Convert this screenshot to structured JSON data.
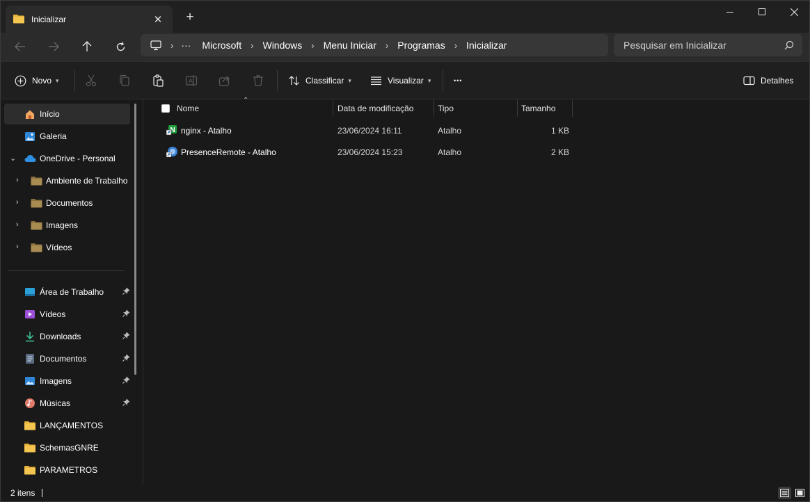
{
  "window": {
    "tab_title": "Inicializar",
    "tab_close": "✕",
    "new_tab": "+",
    "minimize": "minimize",
    "maximize": "maximize",
    "close": "close"
  },
  "address": {
    "overflow": "···",
    "crumbs": [
      "Microsoft",
      "Windows",
      "Menu Iniciar",
      "Programas",
      "Inicializar"
    ],
    "search_placeholder": "Pesquisar em Inicializar"
  },
  "toolbar": {
    "new_label": "Novo",
    "sort_label": "Classificar",
    "view_label": "Visualizar",
    "more_label": "•••",
    "details_label": "Detalhes"
  },
  "sidebar": {
    "top": [
      {
        "label": "Início"
      },
      {
        "label": "Galeria"
      },
      {
        "label": "OneDrive - Personal"
      }
    ],
    "onedrive_children": [
      {
        "label": "Ambiente de Trabalho"
      },
      {
        "label": "Documentos"
      },
      {
        "label": "Imagens"
      },
      {
        "label": "Vídeos"
      }
    ],
    "quick": [
      {
        "label": "Área de Trabalho",
        "pinned": true
      },
      {
        "label": "Vídeos",
        "pinned": true
      },
      {
        "label": "Downloads",
        "pinned": true
      },
      {
        "label": "Documentos",
        "pinned": true
      },
      {
        "label": "Imagens",
        "pinned": true
      },
      {
        "label": "Músicas",
        "pinned": true
      },
      {
        "label": "LANÇAMENTOS",
        "pinned": false
      },
      {
        "label": "SchemasGNRE",
        "pinned": false
      },
      {
        "label": "PARAMETROS",
        "pinned": false
      }
    ]
  },
  "files": {
    "columns": {
      "name": "Nome",
      "modified": "Data de modificação",
      "type": "Tipo",
      "size": "Tamanho"
    },
    "rows": [
      {
        "name": "nginx - Atalho",
        "modified": "23/06/2024 16:11",
        "type": "Atalho",
        "size": "1 KB"
      },
      {
        "name": "PresenceRemote - Atalho",
        "modified": "23/06/2024 15:23",
        "type": "Atalho",
        "size": "2 KB"
      }
    ]
  },
  "status": {
    "count": "2 itens"
  },
  "colors": {
    "accent": "#4cc2ff",
    "folder": "#e8b33a",
    "bg": "#191919"
  }
}
